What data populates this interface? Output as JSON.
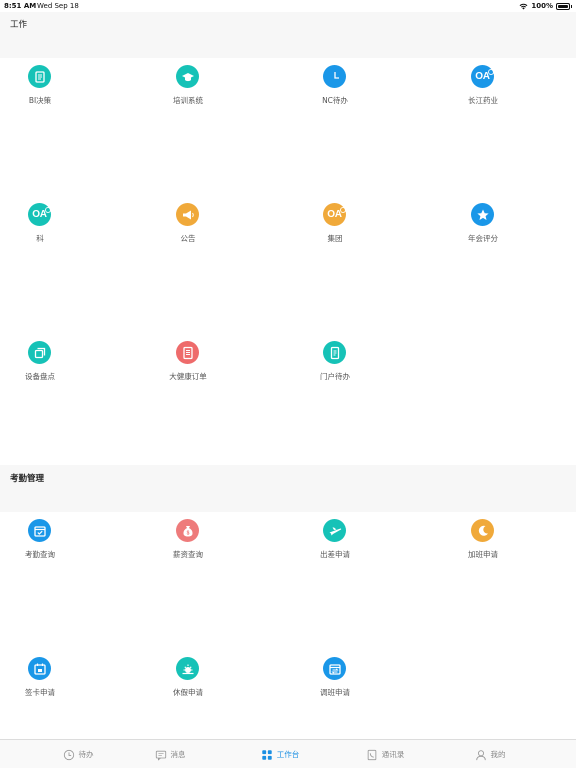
{
  "status_bar": {
    "time": "8:51 AM",
    "date": "Wed Sep 18",
    "battery": "100%"
  },
  "sections": [
    {
      "title": "工作"
    },
    {
      "title": "考勤管理"
    }
  ],
  "work_items": [
    {
      "label": "BI决策",
      "icon": "bi-notebook-icon",
      "color": "#16c2b7"
    },
    {
      "label": "培训系统",
      "icon": "graduation-cap-icon",
      "color": "#16c2b7"
    },
    {
      "label": "NC待办",
      "icon": "clock-icon",
      "color": "#1a97e8"
    },
    {
      "label": "长江药业",
      "icon": "oa-icon",
      "color": "#1a97e8",
      "text": "OA"
    },
    {
      "label": "科",
      "icon": "oa-icon",
      "color": "#16c2b7",
      "text": "OA"
    },
    {
      "label": "公告",
      "icon": "megaphone-icon",
      "color": "#f0a93a"
    },
    {
      "label": "集团",
      "icon": "oa-icon",
      "color": "#f0a93a",
      "text": "OA"
    },
    {
      "label": "年会评分",
      "icon": "star-icon",
      "color": "#1a97e8"
    },
    {
      "label": "设备盘点",
      "icon": "copy-box-icon",
      "color": "#16c2b7"
    },
    {
      "label": "大健康订单",
      "icon": "document-icon",
      "color": "#ee6b6b"
    },
    {
      "label": "门户待办",
      "icon": "tablet-icon",
      "color": "#16c2b7"
    }
  ],
  "attendance_items": [
    {
      "label": "考勤查询",
      "icon": "calendar-check-icon",
      "color": "#1a97e8"
    },
    {
      "label": "薪资查询",
      "icon": "money-bag-icon",
      "color": "#ee7b7b"
    },
    {
      "label": "出差申请",
      "icon": "airplane-icon",
      "color": "#16c2b7"
    },
    {
      "label": "加班申请",
      "icon": "moon-icon",
      "color": "#f0a93a"
    },
    {
      "label": "签卡申请",
      "icon": "punch-card-icon",
      "color": "#1a97e8"
    },
    {
      "label": "休假申请",
      "icon": "sun-icon",
      "color": "#16c2b7"
    },
    {
      "label": "调班申请",
      "icon": "calendar-swap-icon",
      "color": "#1a97e8"
    }
  ],
  "tabs": [
    {
      "label": "待办",
      "icon": "clock-outline-icon",
      "active": false
    },
    {
      "label": "消息",
      "icon": "chat-bubble-icon",
      "active": false
    },
    {
      "label": "工作台",
      "icon": "grid-icon",
      "active": true
    },
    {
      "label": "通讯录",
      "icon": "phone-book-icon",
      "active": false
    },
    {
      "label": "我的",
      "icon": "person-icon",
      "active": false
    }
  ],
  "colors": {
    "active_tab": "#1a8fe3",
    "inactive_tab": "#888888",
    "header_bg": "#f7f7f7"
  }
}
